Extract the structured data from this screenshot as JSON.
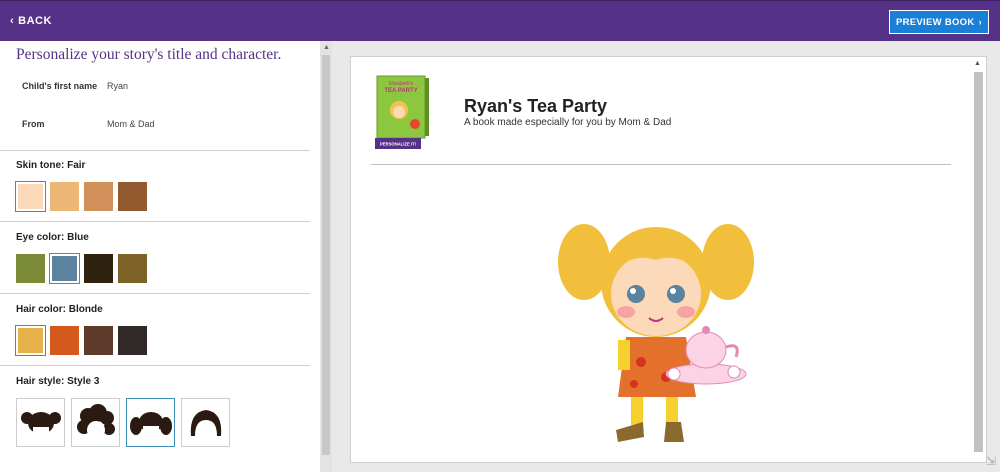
{
  "topbar": {
    "back_label": "BACK",
    "preview_label": "PREVIEW BOOK",
    "color": "#553287",
    "preview_color": "#1a7fd6"
  },
  "panel": {
    "title": "Personalize your story's title and character.",
    "fields": [
      {
        "label": "Child's first name",
        "value": "Ryan"
      },
      {
        "label": "From",
        "value": "Mom & Dad"
      }
    ],
    "skin": {
      "label": "Skin tone: Fair",
      "swatches": [
        "#fcd9b8",
        "#ebb676",
        "#d18f5a",
        "#935a30"
      ],
      "selected": 0
    },
    "eye": {
      "label": "Eye color: Blue",
      "swatches": [
        "#7b8a36",
        "#5b83a0",
        "#2f2310",
        "#7d6328"
      ],
      "selected": 1
    },
    "hair_color": {
      "label": "Hair color: Blonde",
      "swatches": [
        "#e8b24a",
        "#d4591d",
        "#5d3a2a",
        "#312a28"
      ],
      "selected": 0
    },
    "hair_style": {
      "label": "Hair style: Style 3",
      "options": [
        "style-1-icon",
        "style-2-icon",
        "style-3-icon",
        "style-4-icon"
      ],
      "selected": 2
    }
  },
  "book": {
    "title": "Ryan's Tea Party",
    "subtitle": "A book made especially for you by Mom & Dad",
    "cover_badge": "PERSONALIZE IT!",
    "cover_title_line1": "Elizabeth's",
    "cover_title_line2": "TEA PARTY"
  }
}
